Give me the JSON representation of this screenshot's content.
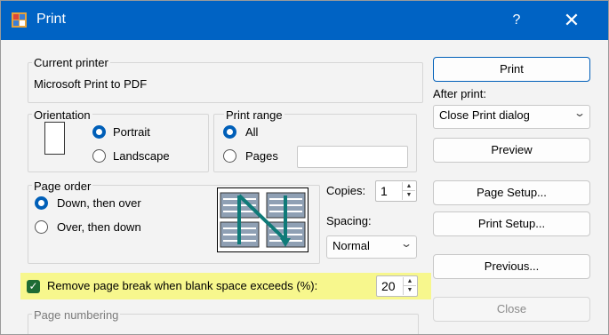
{
  "window": {
    "title": "Print",
    "help": "?",
    "close": "✕",
    "icon": "print-icon"
  },
  "printer": {
    "group_label": "Current printer",
    "name": "Microsoft Print to PDF"
  },
  "orientation": {
    "label": "Orientation",
    "options": [
      {
        "label": "Portrait",
        "checked": true
      },
      {
        "label": "Landscape",
        "checked": false
      }
    ]
  },
  "print_range": {
    "label": "Print range",
    "options": [
      {
        "label": "All",
        "checked": true
      },
      {
        "label": "Pages",
        "checked": false
      }
    ],
    "pages_value": ""
  },
  "page_order": {
    "label": "Page order",
    "options": [
      {
        "label": "Down, then over",
        "checked": true
      },
      {
        "label": "Over, then down",
        "checked": false
      }
    ]
  },
  "copies": {
    "label": "Copies:",
    "value": "1"
  },
  "spacing": {
    "label": "Spacing:",
    "value": "Normal"
  },
  "remove_break": {
    "label": "Remove page break when blank space exceeds (%):",
    "checked": true,
    "value": "20",
    "highlight_color": "#f7f78d"
  },
  "page_numbering": {
    "label": "Page numbering"
  },
  "buttons": {
    "print": "Print",
    "after_print_label": "After print:",
    "after_print_value": "Close Print dialog",
    "preview": "Preview",
    "page_setup": "Page Setup...",
    "print_setup": "Print Setup...",
    "previous": "Previous...",
    "close": "Close"
  },
  "colors": {
    "titlebar": "#0063c4",
    "accent": "#005fb8",
    "checkbox": "#1d6b34"
  }
}
